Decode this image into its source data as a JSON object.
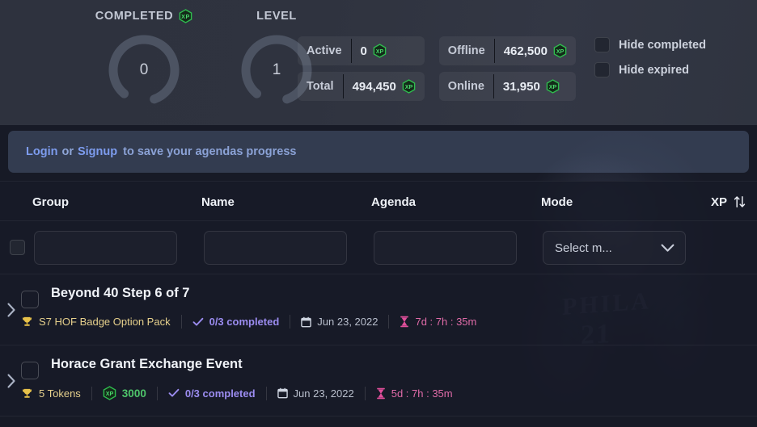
{
  "header": {
    "gauges": [
      {
        "label": "COMPLETED",
        "has_xp_icon": true,
        "value": "0",
        "progress": 0
      },
      {
        "label": "LEVEL",
        "has_xp_icon": false,
        "value": "1",
        "progress": 0
      }
    ],
    "stats": [
      {
        "key": "Active",
        "value": "0",
        "icon": "xp-hex-icon"
      },
      {
        "key": "Offline",
        "value": "462,500",
        "icon": "xp-hex-icon"
      },
      {
        "key": "Total",
        "value": "494,450",
        "icon": "xp-hex-icon"
      },
      {
        "key": "Online",
        "value": "31,950",
        "icon": "xp-hex-icon"
      }
    ],
    "toggles": [
      {
        "label": "Hide completed",
        "checked": false
      },
      {
        "label": "Hide expired",
        "checked": false
      }
    ]
  },
  "banner": {
    "login_label": "Login",
    "or_label": "or",
    "signup_label": "Signup",
    "tail_text": "to save your agendas progress"
  },
  "table": {
    "columns": [
      "Group",
      "Name",
      "Agenda",
      "Mode",
      "XP"
    ],
    "sort_icon": "sort-updown-icon",
    "filters": {
      "select_all_checked": false,
      "group_value": "",
      "group_placeholder": "",
      "name_value": "",
      "name_placeholder": "",
      "agenda_value": "",
      "agenda_placeholder": "",
      "mode_value": "Select m...",
      "mode_options": [
        "Select m..."
      ]
    },
    "rows": [
      {
        "title": "Beyond 40 Step 6 of 7",
        "checked": false,
        "reward": "S7 HOF Badge Option Pack",
        "xp": null,
        "completed": "0/3 completed",
        "date": "Jun 23, 2022",
        "timer": "7d : 7h : 35m"
      },
      {
        "title": "Horace Grant Exchange Event",
        "checked": false,
        "reward": "5 Tokens",
        "xp": "3000",
        "completed": "0/3 completed",
        "date": "Jun 23, 2022",
        "timer": "5d : 7h : 35m"
      }
    ]
  },
  "background": {
    "jersey_text": "PHILA",
    "jersey_number": "21"
  },
  "colors": {
    "page_bg": "#171a26",
    "header_bg": "#2f333f",
    "banner_bg": "#333c50",
    "link": "#7d9cee",
    "xp_green": "#4ec46a",
    "reward_gold": "#e6d08c",
    "completed_purple": "#9b8cf0",
    "timer_pink": "#e06ba8"
  }
}
